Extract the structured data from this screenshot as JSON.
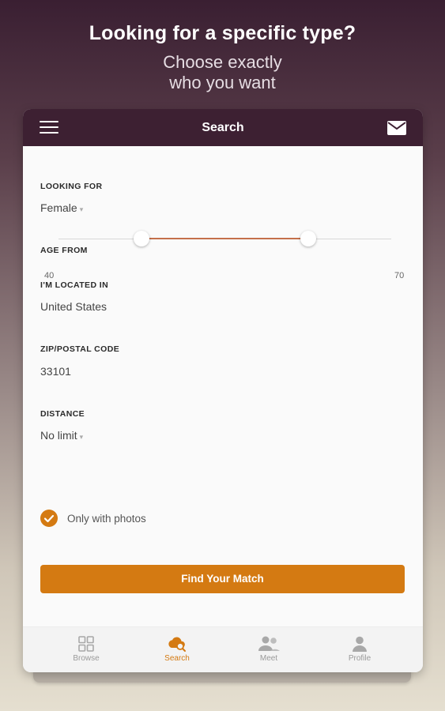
{
  "promo": {
    "title": "Looking for a specific type?",
    "subtitle_line1": "Choose exactly",
    "subtitle_line2": "who you want"
  },
  "topbar": {
    "title": "Search"
  },
  "form": {
    "looking_for": {
      "label": "LOOKING FOR",
      "value": "Female"
    },
    "age": {
      "label": "AGE FROM",
      "min": "40",
      "max": "70",
      "range_fraction": [
        0.25,
        0.75
      ]
    },
    "location": {
      "label": "I'M LOCATED IN",
      "value": "United States"
    },
    "zip": {
      "label": "ZIP/POSTAL CODE",
      "value": "33101"
    },
    "distance": {
      "label": "DISTANCE",
      "value": "No limit"
    },
    "photos": {
      "label": "Only with photos",
      "checked": true
    },
    "submit_label": "Find Your Match"
  },
  "tabs": [
    {
      "label": "Browse",
      "icon": "grid-icon",
      "active": false
    },
    {
      "label": "Search",
      "icon": "search-cloud-icon",
      "active": true
    },
    {
      "label": "Meet",
      "icon": "people-icon",
      "active": false
    },
    {
      "label": "Profile",
      "icon": "person-icon",
      "active": false
    }
  ],
  "colors": {
    "accent": "#d47a12",
    "topbar": "#3d2032",
    "slider_fill": "#c4704a"
  }
}
